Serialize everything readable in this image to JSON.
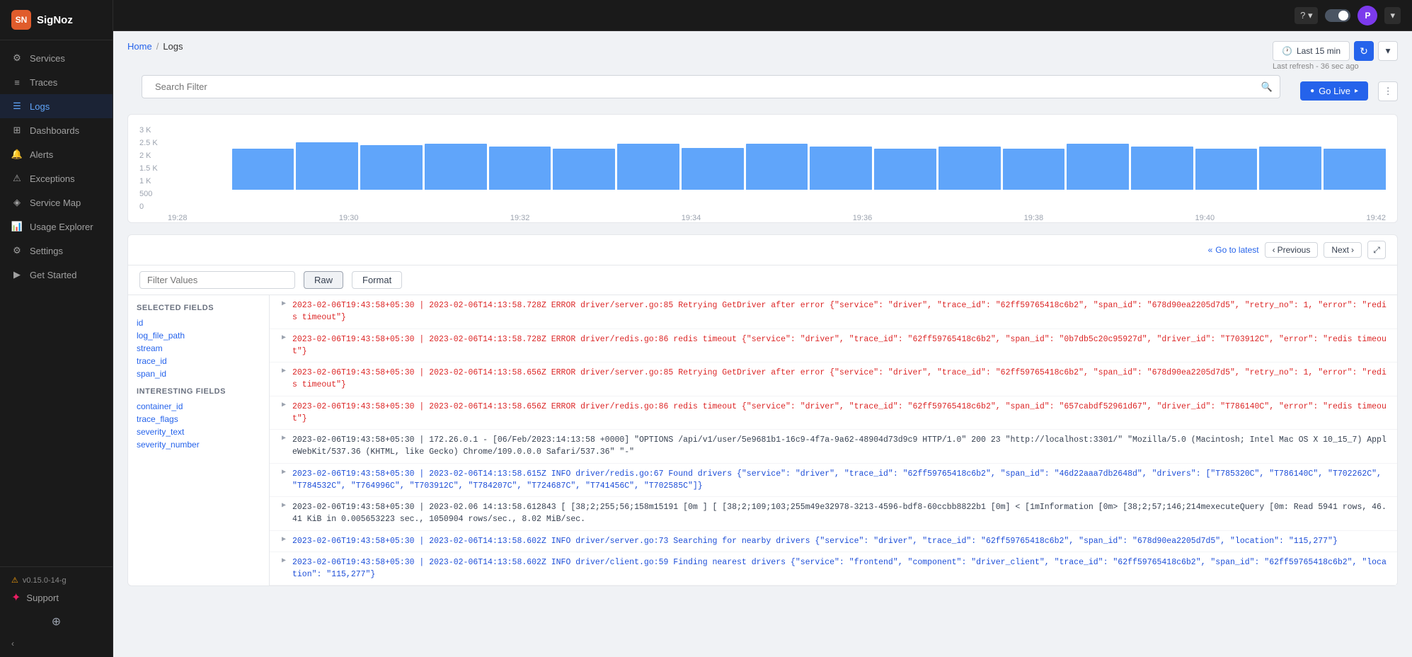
{
  "app": {
    "name": "SigNoz",
    "logo_text": "SN"
  },
  "topbar": {
    "help_label": "?",
    "user_label": "P"
  },
  "sidebar": {
    "items": [
      {
        "id": "services",
        "label": "Services",
        "icon": "services"
      },
      {
        "id": "traces",
        "label": "Traces",
        "icon": "traces"
      },
      {
        "id": "logs",
        "label": "Logs",
        "icon": "logs",
        "active": true
      },
      {
        "id": "dashboards",
        "label": "Dashboards",
        "icon": "dashboards"
      },
      {
        "id": "alerts",
        "label": "Alerts",
        "icon": "alerts"
      },
      {
        "id": "exceptions",
        "label": "Exceptions",
        "icon": "exceptions"
      },
      {
        "id": "service-map",
        "label": "Service Map",
        "icon": "service-map"
      },
      {
        "id": "usage-explorer",
        "label": "Usage Explorer",
        "icon": "usage"
      },
      {
        "id": "settings",
        "label": "Settings",
        "icon": "settings"
      },
      {
        "id": "get-started",
        "label": "Get Started",
        "icon": "get-started"
      }
    ],
    "bottom": {
      "version": "v0.15.0-14-g",
      "support_label": "Support"
    }
  },
  "breadcrumb": {
    "home": "Home",
    "separator": "/",
    "current": "Logs"
  },
  "header": {
    "time_selector": "Last 15 min",
    "last_refresh": "Last refresh - 36 sec ago"
  },
  "search": {
    "placeholder": "Search Filter",
    "go_live_label": "Go Live"
  },
  "chart": {
    "y_labels": [
      "3 K",
      "2.5 K",
      "2 K",
      "1.5 K",
      "1 K",
      "500",
      "0"
    ],
    "x_labels": [
      "19:28",
      "19:30",
      "19:32",
      "19:34",
      "19:36",
      "19:38",
      "19:40",
      "19:42"
    ],
    "bars": [
      0,
      65,
      75,
      70,
      72,
      68,
      65,
      72,
      66,
      72,
      68,
      65,
      68,
      65,
      72,
      68,
      65,
      68,
      65
    ]
  },
  "logs_controls": {
    "go_to_latest_label": "Go to latest",
    "previous_label": "Previous",
    "next_label": "Next",
    "filter_placeholder": "Filter Values",
    "tab_raw": "Raw",
    "tab_format": "Format"
  },
  "selected_fields": {
    "title": "SELECTED FIELDS",
    "items": [
      "id",
      "log_file_path",
      "stream",
      "trace_id",
      "span_id"
    ]
  },
  "interesting_fields": {
    "title": "INTERESTING FIELDS",
    "items": [
      "container_id",
      "trace_flags",
      "severity_text",
      "severity_number"
    ]
  },
  "log_entries": [
    {
      "text": "2023-02-06T19:43:58+05:30 | 2023-02-06T14:13:58.728Z ERROR driver/server.go:85 Retrying GetDriver after error {\"service\": \"driver\", \"trace_id\": \"62ff59765418c6b2\", \"span_id\": \"678d90ea2205d7d5\", \"retry_no\": 1, \"error\": \"redis timeout\"}",
      "level": "error"
    },
    {
      "text": "2023-02-06T19:43:58+05:30 | 2023-02-06T14:13:58.728Z ERROR driver/redis.go:86 redis timeout {\"service\": \"driver\", \"trace_id\": \"62ff59765418c6b2\", \"span_id\": \"0b7db5c20c95927d\", \"driver_id\": \"T703912C\", \"error\": \"redis timeout\"}",
      "level": "error"
    },
    {
      "text": "2023-02-06T19:43:58+05:30 | 2023-02-06T14:13:58.656Z ERROR driver/server.go:85 Retrying GetDriver after error {\"service\": \"driver\", \"trace_id\": \"62ff59765418c6b2\", \"span_id\": \"678d90ea2205d7d5\", \"retry_no\": 1, \"error\": \"redis timeout\"}",
      "level": "error"
    },
    {
      "text": "2023-02-06T19:43:58+05:30 | 2023-02-06T14:13:58.656Z ERROR driver/redis.go:86 redis timeout {\"service\": \"driver\", \"trace_id\": \"62ff59765418c6b2\", \"span_id\": \"657cabdf52961d67\", \"driver_id\": \"T786140C\", \"error\": \"redis timeout\"}",
      "level": "error"
    },
    {
      "text": "2023-02-06T19:43:58+05:30 | 172.26.0.1 - [06/Feb/2023:14:13:58 +0000] \"OPTIONS /api/v1/user/5e9681b1-16c9-4f7a-9a62-48904d73d9c9 HTTP/1.0\" 200 23 \"http://localhost:3301/\" \"Mozilla/5.0 (Macintosh; Intel Mac OS X 10_15_7) AppleWebKit/537.36 (KHTML, like Gecko) Chrome/109.0.0.0 Safari/537.36\" \"-\"",
      "level": "normal"
    },
    {
      "text": "2023-02-06T19:43:58+05:30 | 2023-02-06T14:13:58.615Z INFO driver/redis.go:67 Found drivers {\"service\": \"driver\", \"trace_id\": \"62ff59765418c6b2\", \"span_id\": \"46d22aaa7db2648d\", \"drivers\": [\"T785320C\", \"T786140C\", \"T702262C\", \"T784532C\", \"T764996C\", \"T703912C\", \"T784207C\", \"T724687C\", \"T741456C\", \"T702585C\"]}",
      "level": "info"
    },
    {
      "text": "2023-02-06T19:43:58+05:30 | 2023-02.06 14:13:58.612843 [ [38;2;255;56;158m15191 [0m ] [ [38;2;109;103;255m49e32978-3213-4596-bdf8-60ccbb8822b1 [0m] < [1mInformation [0m> [38;2;57;146;214mexecuteQuery [0m: Read 5941 rows, 46.41 KiB in 0.005653223 sec., 1050904 rows/sec., 8.02 MiB/sec.",
      "level": "normal"
    },
    {
      "text": "2023-02-06T19:43:58+05:30 | 2023-02-06T14:13:58.602Z INFO driver/server.go:73 Searching for nearby drivers {\"service\": \"driver\", \"trace_id\": \"62ff59765418c6b2\", \"span_id\": \"678d90ea2205d7d5\", \"location\": \"115,277\"}",
      "level": "info"
    },
    {
      "text": "2023-02-06T19:43:58+05:30 | 2023-02-06T14:13:58.602Z INFO driver/client.go:59 Finding nearest drivers {\"service\": \"frontend\", \"component\": \"driver_client\", \"trace_id\": \"62ff59765418c6b2\", \"span_id\": \"62ff59765418c6b2\", \"location\": \"115,277\"}",
      "level": "info"
    }
  ]
}
